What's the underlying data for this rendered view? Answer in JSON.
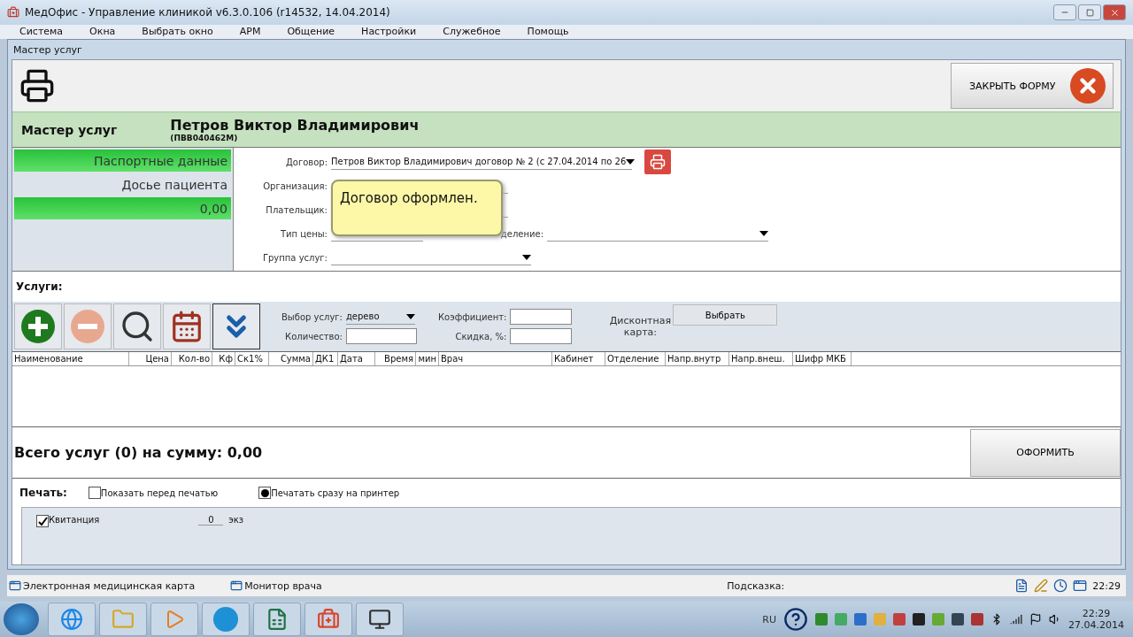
{
  "window": {
    "title": "МедОфис - Управление клиникой v6.3.0.106 (r14532, 14.04.2014)"
  },
  "menu": [
    "Система",
    "Окна",
    "Выбрать окно",
    "АРМ",
    "Общение",
    "Настройки",
    "Служебное",
    "Помощь"
  ],
  "form": {
    "title": "Мастер услуг",
    "close_button": "ЗАКРЫТЬ ФОРМУ"
  },
  "header": {
    "label": "Мастер услуг",
    "patient_name": "Петров Виктор Владимирович",
    "patient_code": "(ПВВ040462М)"
  },
  "side_panel": [
    {
      "label": "Паспортные данные",
      "kind": "highlight"
    },
    {
      "label": "Досье пациента",
      "kind": "plain"
    },
    {
      "label": "0,00",
      "kind": "highlight"
    }
  ],
  "fields": [
    {
      "label": "Договор:",
      "value": "Петров Виктор Владимирович договор № 2 (с 27.04.2014 по 26",
      "kind": "dropdown"
    },
    {
      "label": "Организация:",
      "kind": "text"
    },
    {
      "label": "Плательщик:",
      "kind": "text"
    },
    {
      "label": "Тип цены:",
      "kind": "text"
    },
    {
      "label": "Группа услуг:",
      "kind": "dropdown"
    }
  ],
  "department_field": {
    "label": "деление:"
  },
  "tooltip": "Договор оформлен.",
  "services": {
    "label": "Услуги:",
    "selection_label": "Выбор услуг:",
    "selection_value": "дерево",
    "quantity_label": "Количество:",
    "coefficient_label": "Коэффициент:",
    "discount_label": "Скидка, %:",
    "card_label": "Дисконтная карта:",
    "select_button": "Выбрать"
  },
  "table": {
    "columns": [
      "Наименование",
      "Цена",
      "Кол-во",
      "Кф",
      "Ск1%",
      "Сумма",
      "ДК1",
      "Дата",
      "Время",
      "мин",
      "Врач",
      "Кабинет",
      "Отделение",
      "Напр.внутр",
      "Напр.внеш.",
      "Шифр МКБ"
    ]
  },
  "total": "Всего услуг (0) на сумму: 0,00",
  "submit_button": "ОФОРМИТЬ",
  "print": {
    "label": "Печать:",
    "options": [
      {
        "label": "Показать перед печатью",
        "kind": "checkbox",
        "checked": false
      },
      {
        "label": "Печатать сразу на принтер",
        "kind": "radio",
        "checked": true
      }
    ]
  },
  "receipt": {
    "label": "Квитанция",
    "checked": true,
    "copies": "0",
    "unit": "экз"
  },
  "status_bar": {
    "tabs": [
      "Электронная медицинская карта",
      "Монитор врача"
    ],
    "hint_label": "Подсказка:",
    "time": "22:29"
  },
  "taskbar": {
    "language": "RU",
    "time": "22:29",
    "date": "27.04.2014"
  }
}
